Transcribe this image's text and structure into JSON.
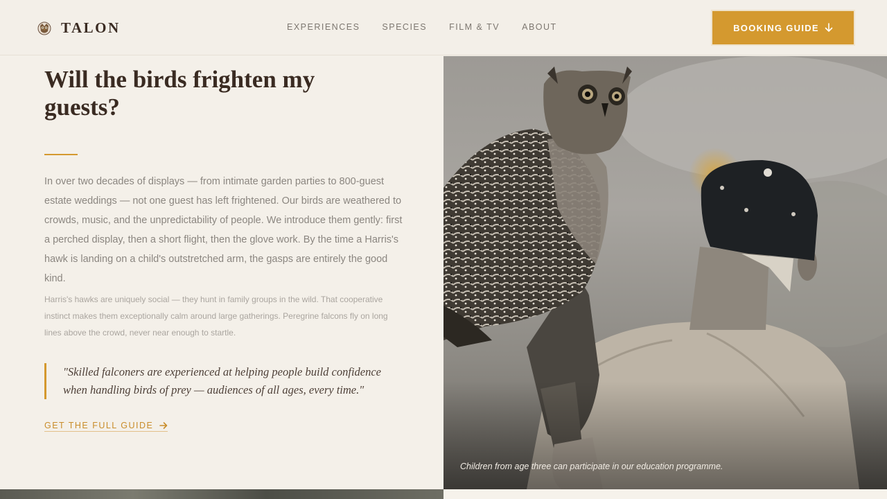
{
  "brand": {
    "name": "TALON",
    "logo_icon": "owl-icon"
  },
  "nav": {
    "items": [
      {
        "label": "EXPERIENCES"
      },
      {
        "label": "SPECIES"
      },
      {
        "label": "FILM & TV"
      },
      {
        "label": "ABOUT"
      }
    ]
  },
  "cta": {
    "label": "BOOKING GUIDE",
    "icon": "arrow-down-icon"
  },
  "colors": {
    "accent": "#d4992f",
    "heading": "#3a2b22",
    "background": "#f4f0e9"
  },
  "section": {
    "title": "Will the birds frighten my guests?",
    "paragraph1": "In over two decades of displays — from intimate garden parties to 800-guest estate weddings — not one guest has left frightened. Our birds are weathered to crowds, music, and the unpredictability of people. We introduce them gently: first a perched display, then a short flight, then the glove work. By the time a Harris's hawk is landing on a child's outstretched arm, the gasps are entirely the good kind.",
    "paragraph2": "Harris's hawks are uniquely social — they hunt in family groups in the wild. That cooperative instinct makes them exceptionally calm around large gatherings. Peregrine falcons fly on long lines above the crowd, never near enough to startle.",
    "quote": "\"Skilled falconers are experienced at helping people build confidence when handling birds of prey — audiences of all ages, every time.\"",
    "link_label": "GET THE FULL GUIDE",
    "link_icon": "arrow-right-icon"
  },
  "photo": {
    "caption": "Children from age three can participate in our education programme."
  }
}
